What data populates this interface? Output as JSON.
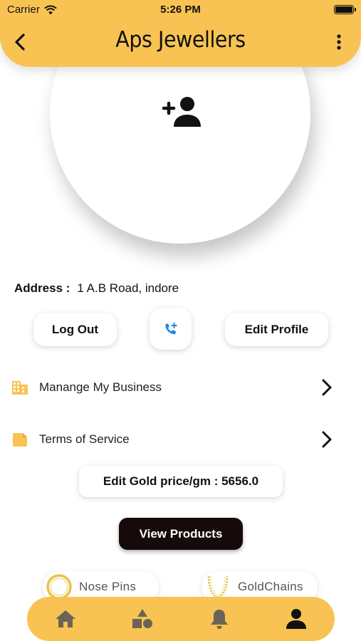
{
  "status_bar": {
    "carrier": "Carrier",
    "time": "5:26 PM"
  },
  "header": {
    "title": "Aps Jewellers"
  },
  "profile": {
    "address_label": "Address :",
    "address_value": "1 A.B Road, indore"
  },
  "actions": {
    "logout_label": "Log Out",
    "edit_profile_label": "Edit Profile"
  },
  "menu": {
    "items": [
      {
        "label": "Manange My Business",
        "icon": "building-icon"
      },
      {
        "label": "Terms of Service",
        "icon": "folder-icon"
      }
    ]
  },
  "gold_price": {
    "label": "Edit Gold price/gm : 5656.0"
  },
  "view_products_label": "View Products",
  "categories": [
    {
      "label": "Nose Pins",
      "icon": "nose-pin-thumbnail"
    },
    {
      "label": "GoldChains",
      "icon": "gold-chain-thumbnail"
    }
  ],
  "bottom_nav": {
    "items": [
      "home-icon",
      "categories-icon",
      "bell-icon",
      "profile-icon"
    ],
    "active": "profile-icon"
  },
  "colors": {
    "accent": "#f8c352",
    "dark_button": "#160a0b",
    "call_icon": "#1e88e5"
  }
}
